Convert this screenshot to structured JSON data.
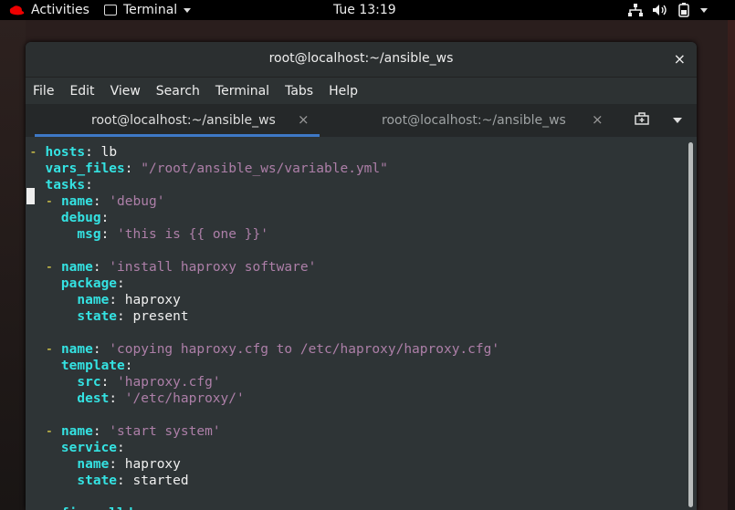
{
  "topbar": {
    "activities": "Activities",
    "app_menu": "Terminal",
    "clock": "Tue 13:19"
  },
  "window": {
    "title": "root@localhost:~/ansible_ws",
    "close": "×"
  },
  "menu": [
    "File",
    "Edit",
    "View",
    "Search",
    "Terminal",
    "Tabs",
    "Help"
  ],
  "tabs": [
    {
      "label": "root@localhost:~/ansible_ws",
      "close": "×"
    },
    {
      "label": "root@localhost:~/ansible_ws",
      "close": "×"
    }
  ],
  "terminal_lines": [
    [
      [
        "d",
        "- "
      ],
      [
        "k",
        "hosts"
      ],
      [
        "p",
        ": lb"
      ]
    ],
    [
      [
        "p",
        "  "
      ],
      [
        "k",
        "vars_files"
      ],
      [
        "p",
        ": "
      ],
      [
        "s",
        "\"/root/ansible_ws/variable.yml\""
      ]
    ],
    [
      [
        "p",
        "  "
      ],
      [
        "k",
        "tasks"
      ],
      [
        "p",
        ":"
      ]
    ],
    [
      [
        "p",
        "  "
      ],
      [
        "d",
        "- "
      ],
      [
        "k",
        "name"
      ],
      [
        "p",
        ": "
      ],
      [
        "s",
        "'debug'"
      ]
    ],
    [
      [
        "p",
        "    "
      ],
      [
        "k",
        "debug"
      ],
      [
        "p",
        ":"
      ]
    ],
    [
      [
        "p",
        "      "
      ],
      [
        "k",
        "msg"
      ],
      [
        "p",
        ": "
      ],
      [
        "s",
        "'this is {{ one }}'"
      ]
    ],
    [
      [
        "p",
        ""
      ]
    ],
    [
      [
        "p",
        "  "
      ],
      [
        "d",
        "- "
      ],
      [
        "k",
        "name"
      ],
      [
        "p",
        ": "
      ],
      [
        "s",
        "'install haproxy software'"
      ]
    ],
    [
      [
        "p",
        "    "
      ],
      [
        "k",
        "package"
      ],
      [
        "p",
        ":"
      ]
    ],
    [
      [
        "p",
        "      "
      ],
      [
        "k",
        "name"
      ],
      [
        "p",
        ": haproxy"
      ]
    ],
    [
      [
        "p",
        "      "
      ],
      [
        "k",
        "state"
      ],
      [
        "p",
        ": present"
      ]
    ],
    [
      [
        "p",
        ""
      ]
    ],
    [
      [
        "p",
        "  "
      ],
      [
        "d",
        "- "
      ],
      [
        "k",
        "name"
      ],
      [
        "p",
        ": "
      ],
      [
        "s",
        "'copying haproxy.cfg to /etc/haproxy/haproxy.cfg'"
      ]
    ],
    [
      [
        "p",
        "    "
      ],
      [
        "k",
        "template"
      ],
      [
        "p",
        ":"
      ]
    ],
    [
      [
        "p",
        "      "
      ],
      [
        "k",
        "src"
      ],
      [
        "p",
        ": "
      ],
      [
        "s",
        "'haproxy.cfg'"
      ]
    ],
    [
      [
        "p",
        "      "
      ],
      [
        "k",
        "dest"
      ],
      [
        "p",
        ": "
      ],
      [
        "s",
        "'/etc/haproxy/'"
      ]
    ],
    [
      [
        "p",
        ""
      ]
    ],
    [
      [
        "p",
        "  "
      ],
      [
        "d",
        "- "
      ],
      [
        "k",
        "name"
      ],
      [
        "p",
        ": "
      ],
      [
        "s",
        "'start system'"
      ]
    ],
    [
      [
        "p",
        "    "
      ],
      [
        "k",
        "service"
      ],
      [
        "p",
        ":"
      ]
    ],
    [
      [
        "p",
        "      "
      ],
      [
        "k",
        "name"
      ],
      [
        "p",
        ": haproxy"
      ]
    ],
    [
      [
        "p",
        "      "
      ],
      [
        "k",
        "state"
      ],
      [
        "p",
        ": started"
      ]
    ],
    [
      [
        "p",
        ""
      ]
    ],
    [
      [
        "p",
        "    "
      ],
      [
        "k",
        "firewalld"
      ],
      [
        "p",
        ":"
      ]
    ]
  ],
  "colors": {
    "key": "#34e2e2",
    "string": "#ad7fa8",
    "dash": "#fce94f",
    "accent": "#3e78c6"
  }
}
